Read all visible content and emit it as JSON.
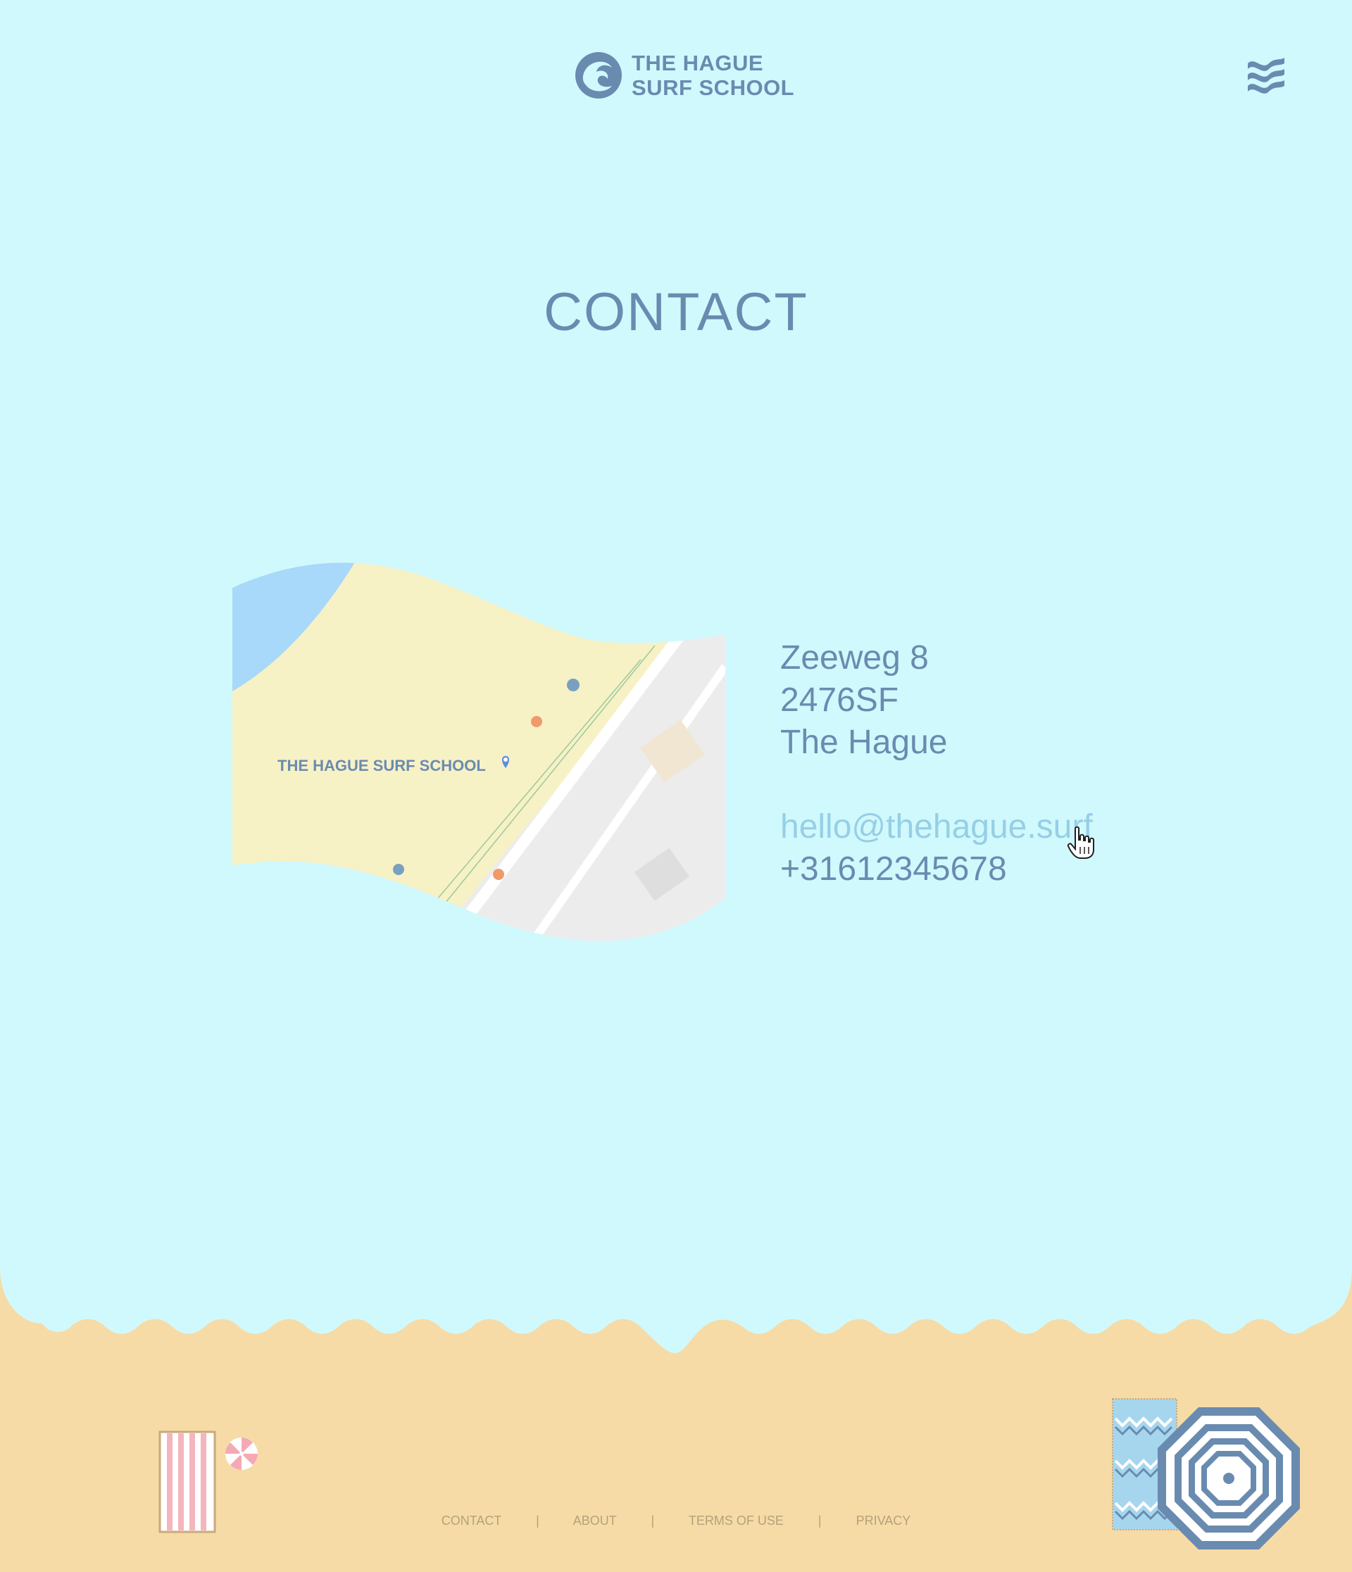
{
  "brand": {
    "line1": "THE HAGUE",
    "line2": "SURF SCHOOL"
  },
  "header": {
    "menu_icon": "waves-menu-icon"
  },
  "page": {
    "title": "CONTACT"
  },
  "map": {
    "label": "THE HAGUE SURF SCHOOL",
    "pin_icon": "map-pin-icon"
  },
  "contact": {
    "street": "Zeeweg 8",
    "postcode": "2476SF",
    "city": "The Hague",
    "email": "hello@thehague.surf",
    "phone": "+31612345678"
  },
  "footer": {
    "links": [
      "CONTACT",
      "ABOUT",
      "TERMS OF USE",
      "PRIVACY"
    ],
    "separator": "|"
  },
  "colors": {
    "sky": "#d0f9fd",
    "sand": "#f6dba6",
    "primary_text": "#6a8bb0",
    "link": "#96cfe6",
    "footer_text": "#b4a17c"
  }
}
